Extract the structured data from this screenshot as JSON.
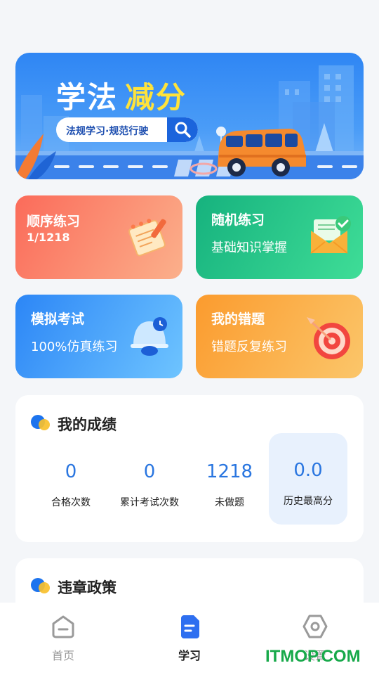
{
  "banner": {
    "title_white": "学法",
    "title_yellow": "减分",
    "search_text": "法规学习·规范行驶"
  },
  "cards": [
    {
      "title": "顺序练习",
      "subtitle": "1/1218",
      "icon": "notepad-pen-icon"
    },
    {
      "title": "随机练习",
      "subtitle": "基础知识掌握",
      "icon": "envelope-check-icon"
    },
    {
      "title": "模拟考试",
      "subtitle": "100%仿真练习",
      "icon": "alarm-bell-icon"
    },
    {
      "title": "我的错题",
      "subtitle": "错题反复练习",
      "icon": "target-arrow-icon"
    }
  ],
  "score": {
    "title": "我的成绩",
    "stats": [
      {
        "value": "0",
        "label": "合格次数"
      },
      {
        "value": "0",
        "label": "累计考试次数"
      },
      {
        "value": "1218",
        "label": "未做题"
      },
      {
        "value": "0.0",
        "label": "历史最高分"
      }
    ]
  },
  "policy": {
    "title": "违章政策"
  },
  "tabs": [
    {
      "label": "首页",
      "icon": "home-icon",
      "active": false
    },
    {
      "label": "学习",
      "icon": "document-icon",
      "active": true
    },
    {
      "label": "设置",
      "icon": "settings-hexagon-icon",
      "active": false
    }
  ],
  "watermark": "ITMOP.COM",
  "colors": {
    "accent": "#2a76e0",
    "background": "#f4f6f9"
  }
}
